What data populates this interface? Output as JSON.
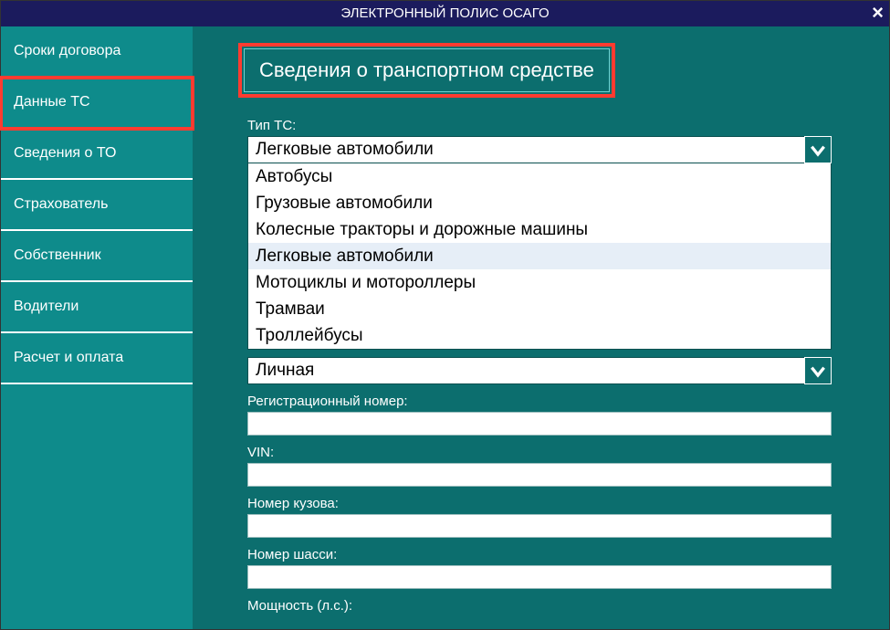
{
  "window": {
    "title": "ЭЛЕКТРОННЫЙ ПОЛИС ОСАГО",
    "close_glyph": "×"
  },
  "sidebar": {
    "items": [
      {
        "label": "Сроки договора"
      },
      {
        "label": "Данные ТС"
      },
      {
        "label": "Сведения о ТО"
      },
      {
        "label": "Страхователь"
      },
      {
        "label": "Собственник"
      },
      {
        "label": "Водители"
      },
      {
        "label": "Расчет и оплата"
      }
    ],
    "active_index": 1
  },
  "main": {
    "section_title": "Сведения о транспортном средстве",
    "fields": {
      "type_label": "Тип ТС:",
      "type_value": "Легковые автомобили",
      "type_options": [
        "Автобусы",
        "Грузовые автомобили",
        "Колесные тракторы и дорожные машины",
        "Легковые автомобили",
        "Мотоциклы и мотороллеры",
        "Трамваи",
        "Троллейбусы"
      ],
      "type_hover_index": 3,
      "purpose_value": "Личная",
      "reg_label": "Регистрационный номер:",
      "reg_value": "",
      "vin_label": "VIN:",
      "vin_value": "",
      "body_label": "Номер кузова:",
      "body_value": "",
      "chassis_label": "Номер шасси:",
      "chassis_value": "",
      "power_label": "Мощность (л.с.):"
    }
  }
}
